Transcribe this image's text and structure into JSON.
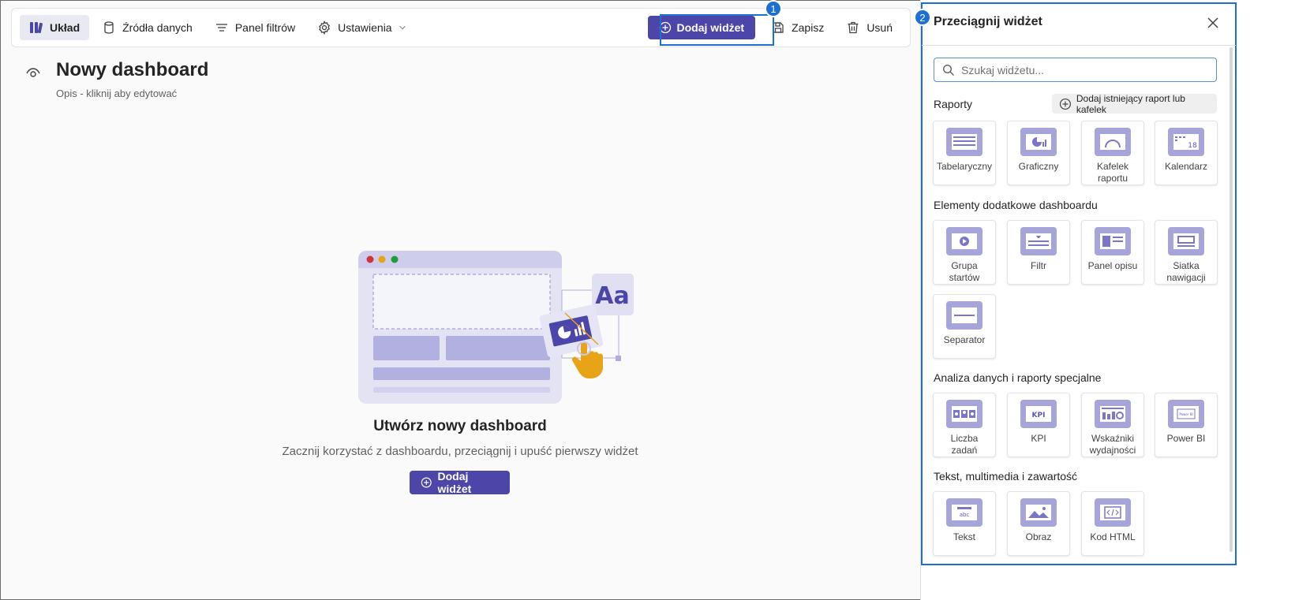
{
  "toolbar": {
    "layout_label": "Układ",
    "datasources_label": "Źródła danych",
    "filters_label": "Panel filtrów",
    "settings_label": "Ustawienia",
    "add_widget_label": "Dodaj widżet",
    "save_label": "Zapisz",
    "delete_label": "Usuń",
    "marker1": "1"
  },
  "main": {
    "title": "Nowy dashboard",
    "description": "Opis - kliknij aby edytować",
    "empty_title": "Utwórz nowy dashboard",
    "empty_subtitle": "Zacznij korzystać z dashboardu, przeciągnij i upuść pierwszy widżet",
    "empty_button": "Dodaj widżet",
    "illustration_text": "Aa"
  },
  "panel": {
    "marker2": "2",
    "title": "Przeciągnij widżet",
    "search_placeholder": "Szukaj widżetu...",
    "add_existing_label": "Dodaj istniejący raport lub kafelek",
    "sections": [
      {
        "label": "Raporty",
        "tiles": [
          "Tabelaryczny",
          "Graficzny",
          "Kafelek raportu",
          "Kalendarz"
        ]
      },
      {
        "label": "Elementy dodatkowe dashboardu",
        "tiles": [
          "Grupa startów",
          "Filtr",
          "Panel opisu",
          "Siatka nawigacji",
          "Separator"
        ]
      },
      {
        "label": "Analiza danych i raporty specjalne",
        "tiles": [
          "Liczba zadań",
          "KPI",
          "Wskaźniki wydajności",
          "Power BI"
        ]
      },
      {
        "label": "Tekst, multimedia i zawartość",
        "tiles": [
          "Tekst",
          "Obraz",
          "Kod HTML"
        ]
      }
    ],
    "icon_texts": {
      "calendar": "18",
      "kpi": "KPI",
      "text": "abc",
      "powerbi": "Power BI"
    }
  },
  "colors": {
    "accent": "#4b46a8",
    "highlight": "#1d6fd6",
    "tile_icon": "#a6a4d9"
  }
}
